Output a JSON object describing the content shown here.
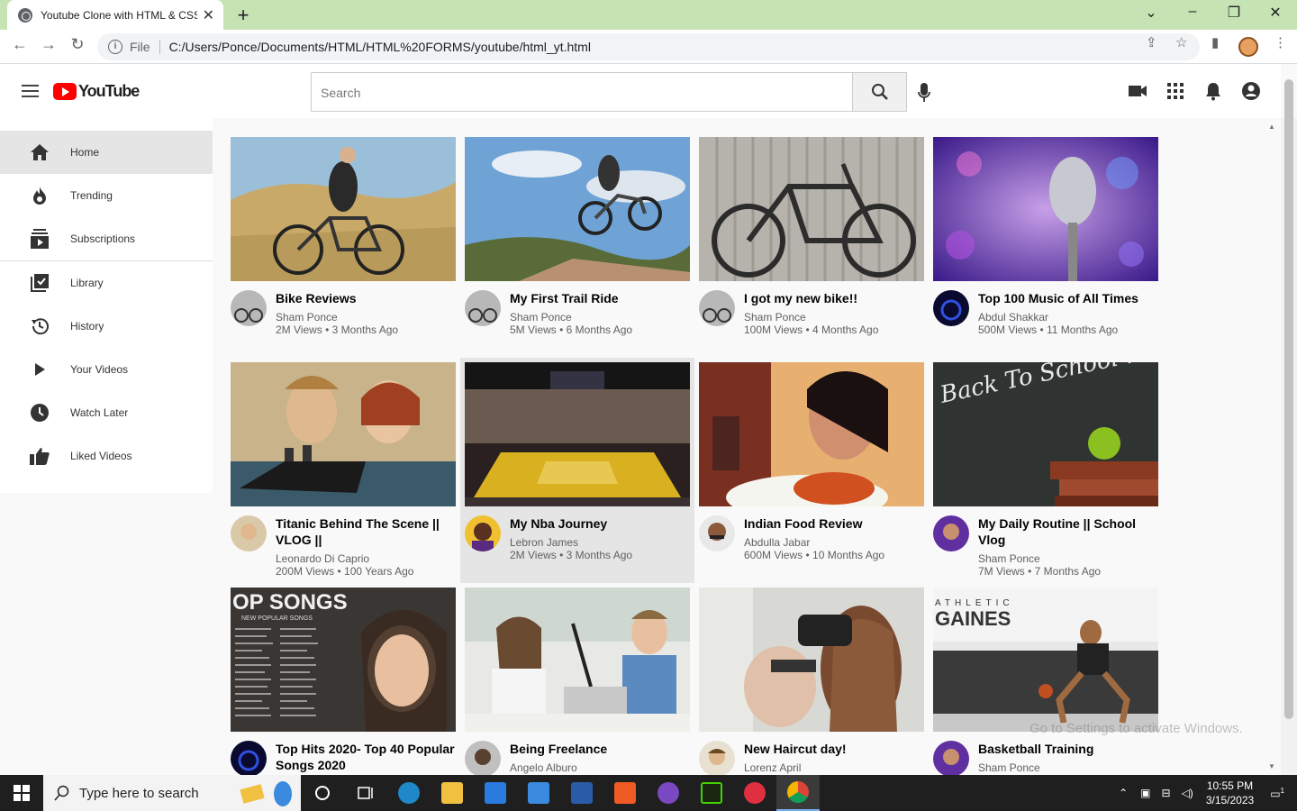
{
  "browser": {
    "tab_title": "Youtube Clone with HTML & CSS",
    "tab_close": "✕",
    "new_tab": "+",
    "file_label": "File",
    "url": "C:/Users/Ponce/Documents/HTML/HTML%20FORMS/youtube/html_yt.html"
  },
  "header": {
    "logo_text": "YouTube",
    "search_placeholder": "Search"
  },
  "sidebar": {
    "items": [
      {
        "label": "Home",
        "icon": "home-icon"
      },
      {
        "label": "Trending",
        "icon": "fire-icon"
      },
      {
        "label": "Subscriptions",
        "icon": "subscriptions-icon"
      },
      {
        "label": "Library",
        "icon": "library-icon"
      },
      {
        "label": "History",
        "icon": "history-icon"
      },
      {
        "label": "Your Videos",
        "icon": "play-icon"
      },
      {
        "label": "Watch Later",
        "icon": "clock-icon"
      },
      {
        "label": "Liked Videos",
        "icon": "thumbs-up-icon"
      }
    ]
  },
  "videos": [
    {
      "title": "Bike Reviews",
      "channel": "Sham Ponce",
      "stats": "2M Views • 3 Months Ago"
    },
    {
      "title": "My First Trail Ride",
      "channel": "Sham Ponce",
      "stats": "5M Views • 6 Months Ago"
    },
    {
      "title": "I got my new bike!!",
      "channel": "Sham Ponce",
      "stats": "100M Views • 4 Months Ago"
    },
    {
      "title": "Top 100 Music of All Times",
      "channel": "Abdul Shakkar",
      "stats": "500M Views • 11 Months Ago"
    },
    {
      "title": "Titanic Behind The Scene || VLOG ||",
      "channel": "Leonardo Di Caprio",
      "stats": "200M Views • 100 Years Ago"
    },
    {
      "title": "My Nba Journey",
      "channel": "Lebron James",
      "stats": "2M Views • 3 Months Ago"
    },
    {
      "title": "Indian Food Review",
      "channel": "Abdulla Jabar",
      "stats": "600M Views • 10 Months Ago"
    },
    {
      "title": "My Daily Routine || School Vlog",
      "channel": "Sham Ponce",
      "stats": "7M Views • 7 Months Ago"
    },
    {
      "title": "Top Hits 2020- Top 40 Popular Songs 2020",
      "channel": "",
      "stats": ""
    },
    {
      "title": "Being Freelance",
      "channel": "Angelo Alburo",
      "stats": ""
    },
    {
      "title": "New Haircut day!",
      "channel": "Lorenz April",
      "stats": ""
    },
    {
      "title": "Basketball Training",
      "channel": "Sham Ponce",
      "stats": ""
    }
  ],
  "thumb_text": {
    "school": "Back To School !",
    "songs": "OP SONGS",
    "songs_sub": "NEW POPULAR SONGS",
    "gym": "ATHLETIC",
    "gym2": "GAINES"
  },
  "watermark": "Go to Settings to activate Windows.",
  "taskbar": {
    "search_placeholder": "Type here to search",
    "time": "10:55 PM",
    "date": "3/15/2023",
    "notif_count": "1"
  }
}
